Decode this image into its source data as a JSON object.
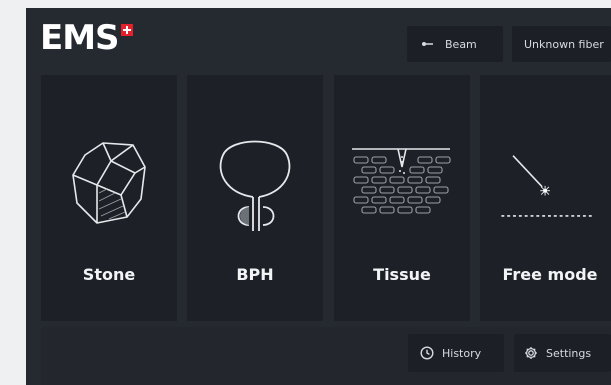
{
  "header": {
    "logo_text": "EMS",
    "beam_label": "Beam",
    "fiber_label": "Unknown fiber"
  },
  "tiles": [
    {
      "label": "Stone",
      "icon": "stone-icon"
    },
    {
      "label": "BPH",
      "icon": "bph-icon"
    },
    {
      "label": "Tissue",
      "icon": "tissue-icon"
    },
    {
      "label": "Free mode",
      "icon": "free-mode-icon"
    }
  ],
  "footer": {
    "history_label": "History",
    "settings_label": "Settings"
  },
  "colors": {
    "background": "#252a31",
    "tile": "#1d2127",
    "button": "#1c2026",
    "text": "#f2f3f5",
    "swiss_red": "#e4202a"
  }
}
